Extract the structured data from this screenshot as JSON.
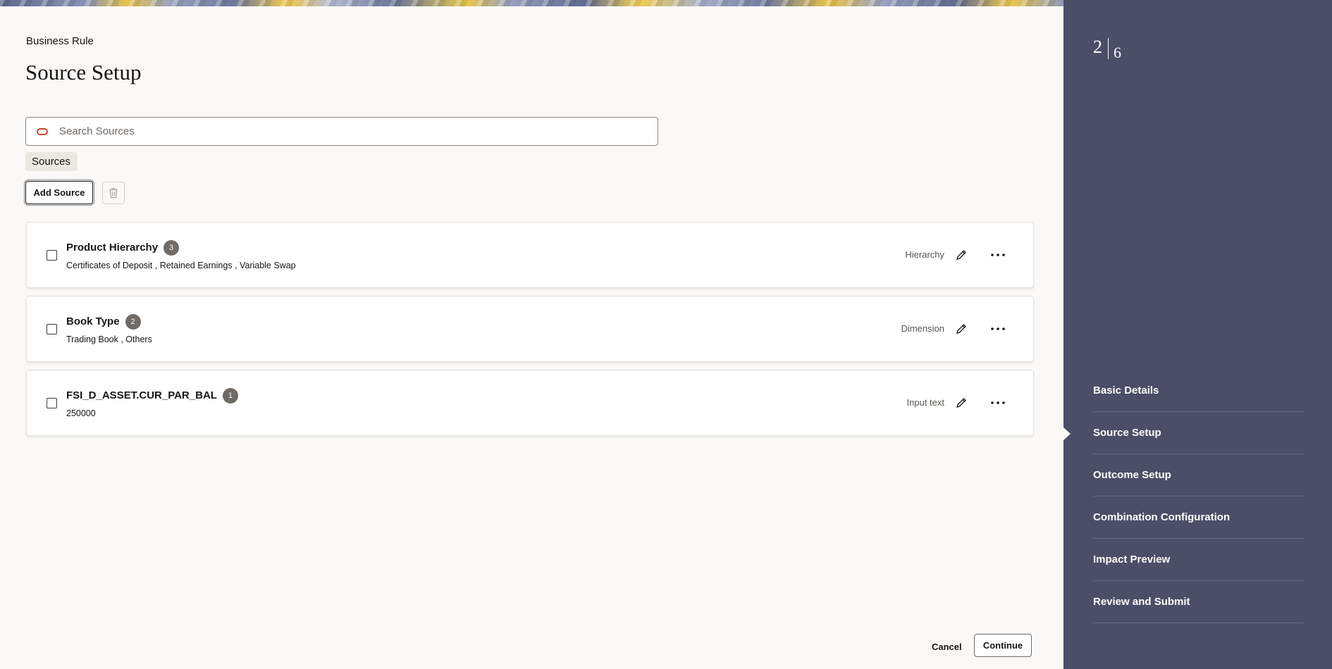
{
  "header": {
    "eyebrow": "Business Rule",
    "title": "Source Setup"
  },
  "search": {
    "placeholder": "Search Sources",
    "icon": "oracle-icon"
  },
  "filter_chip": "Sources",
  "toolbar": {
    "add_label": "Add Source",
    "delete_icon": "trash-icon"
  },
  "sources": [
    {
      "title": "Product Hierarchy",
      "count": "3",
      "subtitle": "Certificates of Deposit , Retained Earnings , Variable Swap",
      "type": "Hierarchy"
    },
    {
      "title": "Book Type",
      "count": "2",
      "subtitle": "Trading Book , Others",
      "type": "Dimension"
    },
    {
      "title": "FSI_D_ASSET.CUR_PAR_BAL",
      "count": "1",
      "subtitle": "250000",
      "type": "Input text"
    }
  ],
  "footer": {
    "cancel_label": "Cancel",
    "continue_label": "Continue"
  },
  "train": {
    "current": "2",
    "total": "6",
    "steps": [
      "Basic Details",
      "Source Setup",
      "Outcome Setup",
      "Combination Configuration",
      "Impact Preview",
      "Review and Submit"
    ],
    "active_step": "Source Setup"
  },
  "colors": {
    "panel_bg": "#4a4e67",
    "page_bg": "#fbf9f8",
    "brand_red": "#c74634",
    "badge": "#6f6a66"
  }
}
